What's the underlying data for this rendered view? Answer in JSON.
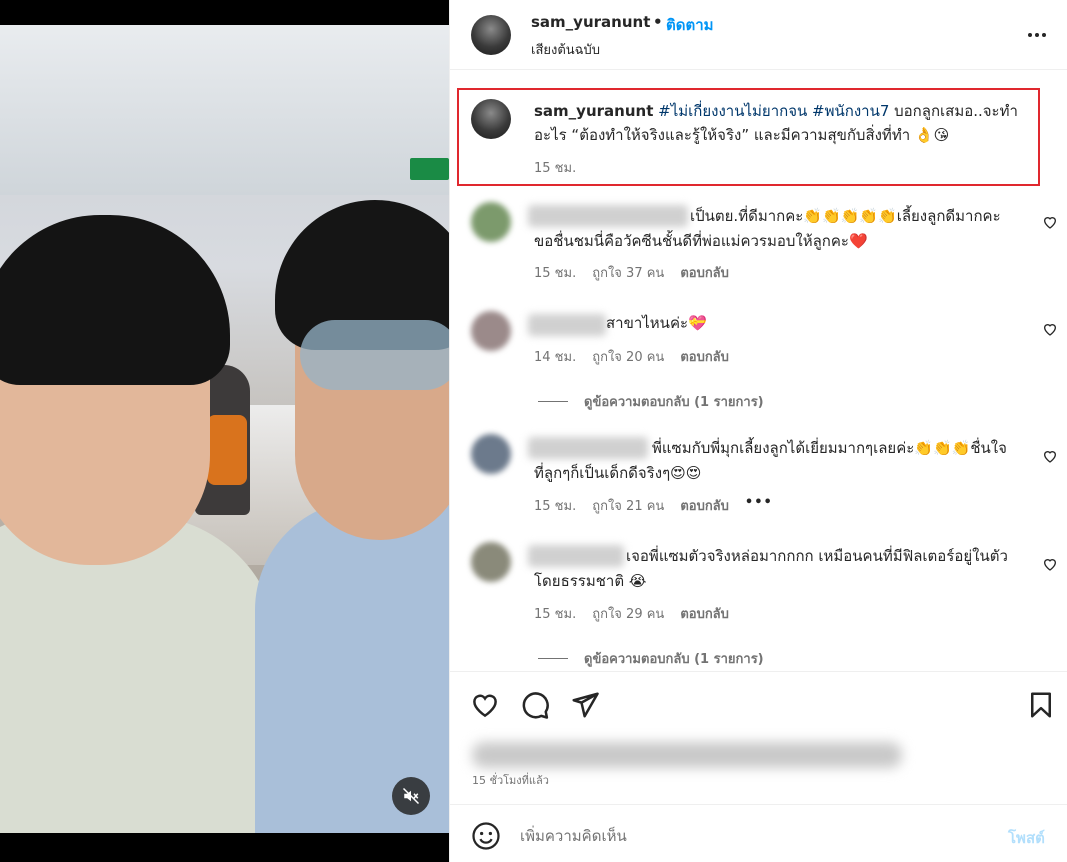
{
  "header": {
    "username": "sam_yuranunt",
    "dot": "•",
    "follow_label": "ติดตาม",
    "audio_label": "เสียงต้นฉบับ"
  },
  "caption": {
    "username": "sam_yuranunt",
    "hashtag1": "#ไม่เกี่ยงงานไม่ยากจน",
    "hashtag2": "#พนักงาน7",
    "text": "บอกลูกเสมอ..จะทำอะไร “ต้องทำให้จริงและรู้ให้จริง” และมีความสุขกับสิ่งที่ทำ 👌😘",
    "time": "15 ชม."
  },
  "comments": [
    {
      "text": "เป็นตย.ที่ดีมากคะ👏👏👏👏👏เลี้ยงลูกดีมากคะขอชื่นชมนี่คือวัคซีนชั้นดีที่พ่อแม่ควรมอบให้ลูกคะ❤️",
      "time": "15 ชม.",
      "likes": "ถูกใจ 37 คน",
      "reply": "ตอบกลับ"
    },
    {
      "text": "สาขาไหนค่ะ💝",
      "time": "14 ชม.",
      "likes": "ถูกใจ 20 คน",
      "reply": "ตอบกลับ",
      "view_replies": "ดูข้อความตอบกลับ (1 รายการ)"
    },
    {
      "text": "พี่แซมกับพี่มุกเลี้ยงลูกได้เยี่ยมมากๆเลยค่ะ👏👏👏ชื่นใจที่ลูกๆก็เป็นเด็กดีจริงๆ😍😍",
      "time": "15 ชม.",
      "likes": "ถูกใจ 21 คน",
      "reply": "ตอบกลับ",
      "more": "•••"
    },
    {
      "text": "เจอพี่แซมตัวจริงหล่อมากกกก เหมือนคนที่มีฟิลเตอร์อยู่ในตัวโดยธรรมชาติ 😭",
      "time": "15 ชม.",
      "likes": "ถูกใจ 29 คน",
      "reply": "ตอบกลับ",
      "view_replies": "ดูข้อความตอบกลับ (1 รายการ)"
    }
  ],
  "footer": {
    "timestamp": "15 ชั่วโมงที่แล้ว",
    "comment_placeholder": "เพิ่มความคิดเห็น",
    "post_label": "โพสต์"
  },
  "icons": {
    "mute": "speaker-muted-icon",
    "like": "heart-icon",
    "comment": "comment-bubble-icon",
    "share": "paper-plane-icon",
    "save": "bookmark-icon",
    "emoji": "smiley-icon",
    "more": "more-options-icon"
  },
  "colors": {
    "follow": "#0095f6",
    "highlight_box": "#e0282e",
    "muted_text": "#737373",
    "post_disabled": "#b2dffc"
  }
}
